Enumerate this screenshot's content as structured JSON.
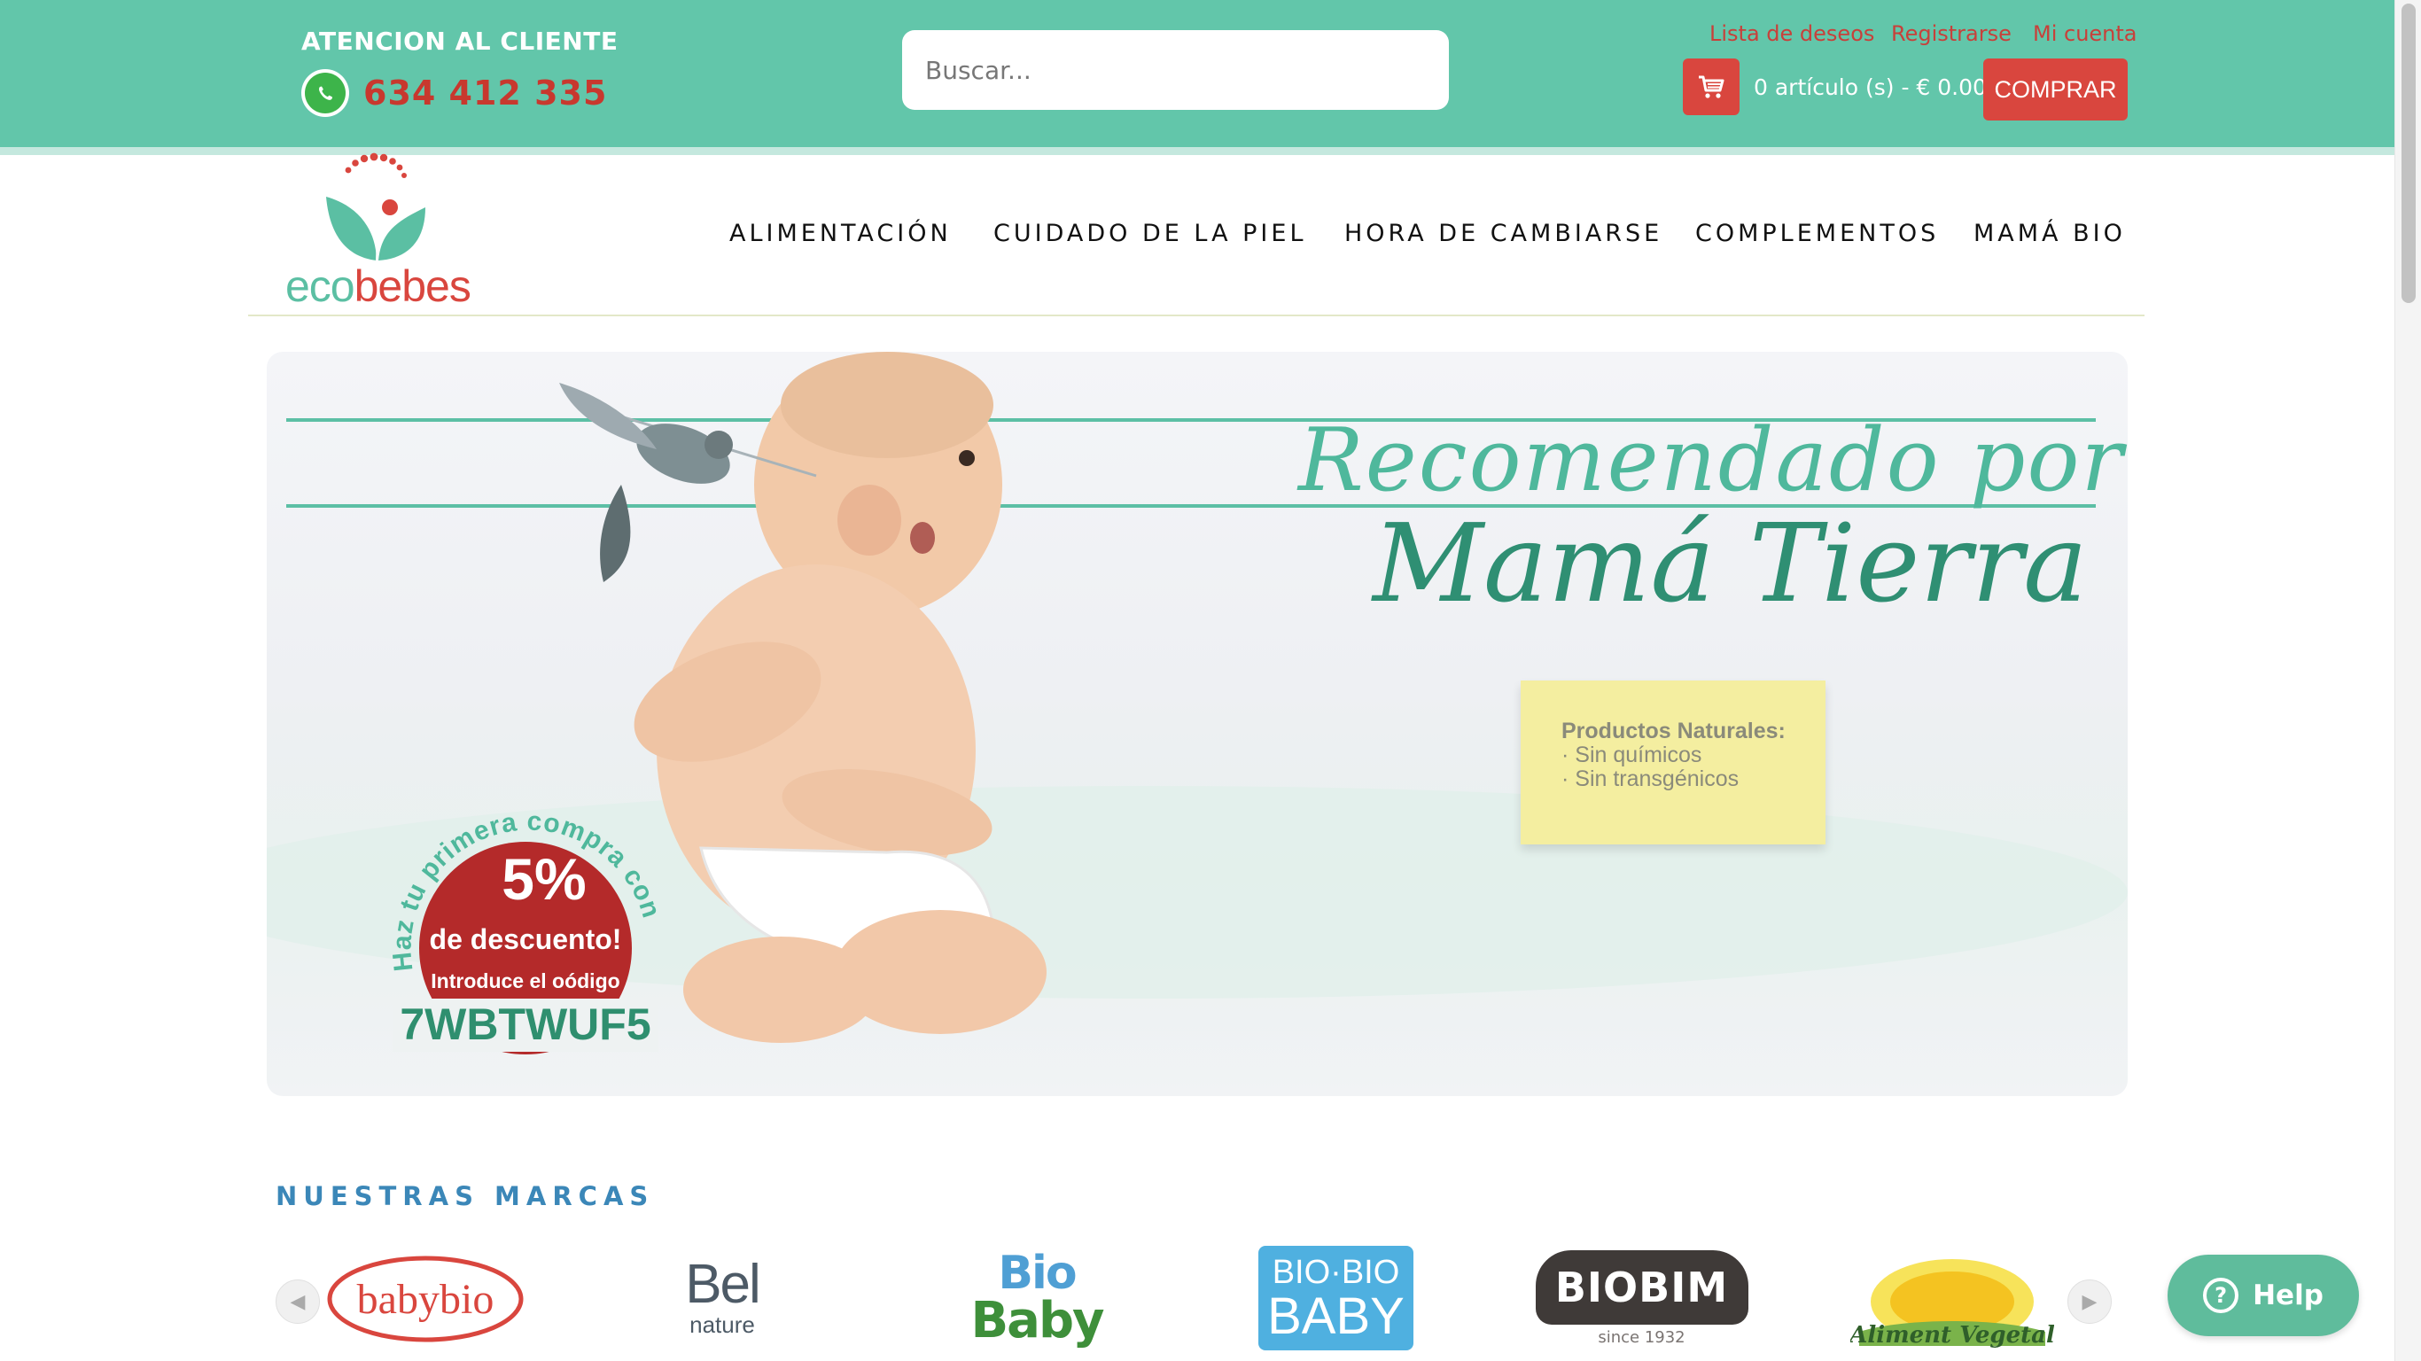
{
  "header": {
    "customer_service_label": "ATENCION AL CLIENTE",
    "phone": "634 412 335",
    "search_placeholder": "Buscar...",
    "links": {
      "wishlist": "Lista de deseos",
      "register": "Registrarse",
      "account": "Mi cuenta"
    },
    "cart_summary": "0 artículo (s) - € 0.00",
    "buy_button": "COMPRAR"
  },
  "logo": {
    "eco": "eco",
    "bebes": "bebes"
  },
  "nav": {
    "items": [
      "ALIMENTACIÓN",
      "CUIDADO DE LA PIEL",
      "HORA DE CAMBIARSE",
      "COMPLEMENTOS",
      "MAMÁ BIO"
    ]
  },
  "hero": {
    "headline_line1": "Recomendado por",
    "headline_line2": "Mamá Tierra",
    "note_title": "Productos Naturales:",
    "note_items": [
      "· Sin químicos",
      "· Sin transgénicos"
    ],
    "promo": {
      "arc_text": "Haz tu primera compra con un",
      "percent": "5%",
      "discount": "de descuento!",
      "instruction": "Introduce el oódigo",
      "code": "7WBTWUF5"
    }
  },
  "brands": {
    "title": "NUESTRAS MARCAS",
    "items": [
      {
        "name": "babybio",
        "line2": ""
      },
      {
        "name": "Bel",
        "line2": "nature"
      },
      {
        "name": "Bio",
        "line2": "Baby"
      },
      {
        "name": "BIO·BIO",
        "line2": "BABY"
      },
      {
        "name": "BIOBIM",
        "line2": "since 1932"
      },
      {
        "name": "Aliment Vegetal",
        "line2": ""
      }
    ]
  },
  "help": {
    "label": "Help"
  },
  "colors": {
    "header_bg": "#62c6aa",
    "accent_red": "#d9463e",
    "brand_green": "#5bbfa3",
    "brands_title_blue": "#3b87b8"
  }
}
